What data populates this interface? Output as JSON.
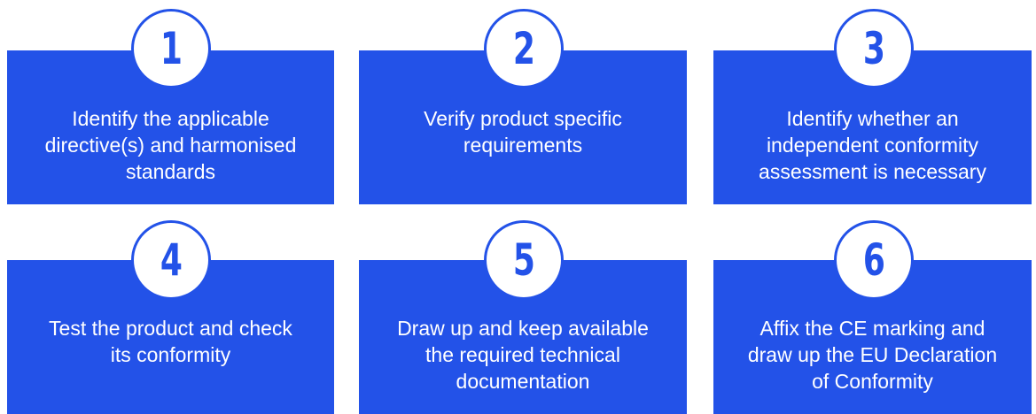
{
  "colors": {
    "card": "#2352e8",
    "circle_border": "#2352e8",
    "number": "#2352e8",
    "card_text": "#ffffff"
  },
  "steps": [
    {
      "number": "1",
      "lines": [
        "Identify the applicable",
        "directive(s) and harmonised",
        "standards"
      ]
    },
    {
      "number": "2",
      "lines": [
        "Verify product specific",
        "requirements"
      ]
    },
    {
      "number": "3",
      "lines": [
        "Identify whether an",
        "independent conformity",
        "assessment is necessary"
      ]
    },
    {
      "number": "4",
      "lines": [
        "Test the product and check",
        "its conformity"
      ]
    },
    {
      "number": "5",
      "lines": [
        "Draw up and keep available",
        "the required technical",
        "documentation"
      ]
    },
    {
      "number": "6",
      "lines": [
        "Affix the CE marking and",
        "draw up the EU Declaration",
        "of Conformity"
      ]
    }
  ]
}
